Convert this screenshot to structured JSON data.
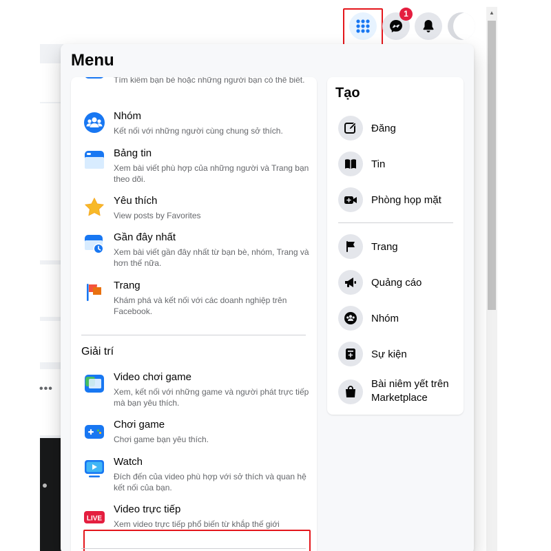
{
  "top_bar": {
    "messenger_badge": "1",
    "icons": [
      "grid-menu-icon",
      "messenger-icon",
      "bell-icon"
    ]
  },
  "menu": {
    "title": "Menu",
    "partial_item": {
      "desc": "Tìm kiếm bạn bè hoặc những người bạn có thể biết."
    },
    "items": [
      {
        "title": "Nhóm",
        "desc": "Kết nối với những người cùng chung sở thích.",
        "icon": "groups-icon"
      },
      {
        "title": "Bảng tin",
        "desc": "Xem bài viết phù hợp của những người và Trang bạn theo dõi.",
        "icon": "news-feed-icon"
      },
      {
        "title": "Yêu thích",
        "desc": "View posts by Favorites",
        "icon": "star-icon"
      },
      {
        "title": "Gần đây nhất",
        "desc": "Xem bài viết gần đây nhất từ bạn bè, nhóm, Trang và hơn thế nữa.",
        "icon": "recent-clock-icon"
      },
      {
        "title": "Trang",
        "desc": "Khám phá và kết nối với các doanh nghiệp trên Facebook.",
        "icon": "flag-icon"
      }
    ],
    "entertainment_section": {
      "title": "Giải trí",
      "items": [
        {
          "title": "Video chơi game",
          "desc": "Xem, kết nối với những game và người phát trực tiếp mà bạn yêu thích.",
          "icon": "gaming-video-icon"
        },
        {
          "title": "Chơi game",
          "desc": "Chơi game bạn yêu thích.",
          "icon": "gamepad-icon"
        },
        {
          "title": "Watch",
          "desc": "Đích đến của video phù hợp với sở thích và quan hệ kết nối của bạn.",
          "icon": "watch-icon"
        },
        {
          "title": "Video trực tiếp",
          "desc": "Xem video trực tiếp phổ biến từ khắp thế giới",
          "icon": "live-icon",
          "badge": "LIVE"
        }
      ]
    }
  },
  "create": {
    "title": "Tạo",
    "items": [
      {
        "label": "Đăng",
        "icon": "edit-icon"
      },
      {
        "label": "Tin",
        "icon": "book-icon"
      },
      {
        "label": "Phòng họp mặt",
        "icon": "video-room-icon"
      },
      {
        "label": "Trang",
        "icon": "flag-icon"
      },
      {
        "label": "Quảng cáo",
        "icon": "megaphone-icon"
      },
      {
        "label": "Nhóm",
        "icon": "groups-icon"
      },
      {
        "label": "Sự kiện",
        "icon": "calendar-icon"
      },
      {
        "label": "Bài niêm yết trên Marketplace",
        "icon": "shopping-bag-icon"
      }
    ]
  },
  "colors": {
    "accent": "#1877f2",
    "highlight_red": "#e4161b",
    "badge_red": "#e41e3f"
  }
}
